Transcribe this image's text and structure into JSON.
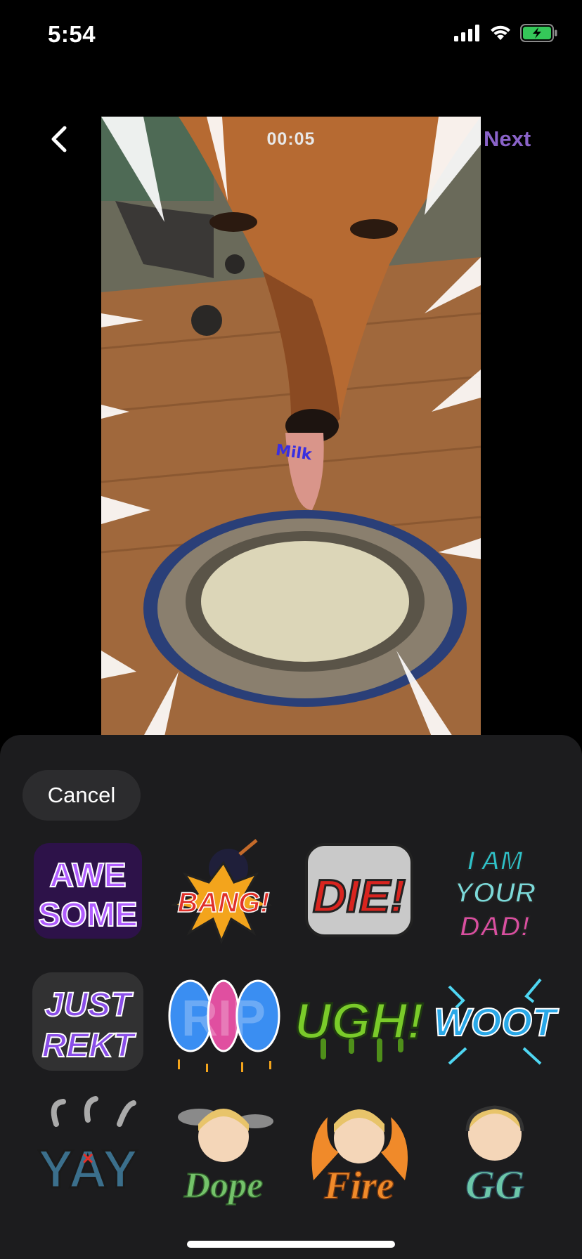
{
  "status": {
    "time": "5:54",
    "icons": [
      "signal-icon",
      "wifi-icon",
      "battery-charging-icon"
    ]
  },
  "nav": {
    "back_icon": "chevron-left-icon",
    "next_label": "Next"
  },
  "video": {
    "timer": "00:05",
    "overlay_text": "Milk"
  },
  "sheet": {
    "cancel_label": "Cancel",
    "stickers": [
      {
        "id": "awesome",
        "text": "AWE SOME",
        "color": "#9b3df2"
      },
      {
        "id": "bang",
        "text": "BANG!",
        "color": "#f3a41c"
      },
      {
        "id": "die",
        "text": "DIE!",
        "color": "#d9241f"
      },
      {
        "id": "i-am-your-dad",
        "text": "I AM YOUR DAD!",
        "color": "#2fc2c9"
      },
      {
        "id": "just-rekt",
        "text": "JUST REKT",
        "color": "#8a4ee8"
      },
      {
        "id": "rip",
        "text": "RIP",
        "color": "#3a8ef2"
      },
      {
        "id": "ugh",
        "text": "UGH!",
        "color": "#7acb2a"
      },
      {
        "id": "woot",
        "text": "WOOT",
        "color": "#29a8e8"
      },
      {
        "id": "yay",
        "text": "YAY",
        "color": "#3b6f8c"
      },
      {
        "id": "dope",
        "text": "Dope",
        "color": "#74c26a"
      },
      {
        "id": "fire",
        "text": "Fire",
        "color": "#f08a2a"
      },
      {
        "id": "gg",
        "text": "GG",
        "color": "#6cc7a9"
      }
    ]
  },
  "colors": {
    "accent": "#8a63c9",
    "sheet_bg": "#1c1c1e",
    "button_bg": "#2c2c2e"
  }
}
